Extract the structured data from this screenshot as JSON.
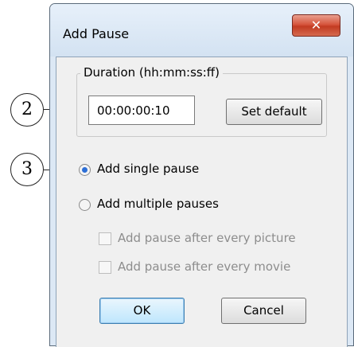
{
  "dialog": {
    "title": "Add Pause",
    "close_glyph": "✕"
  },
  "duration": {
    "group_label": "Duration (hh:mm:ss:ff)",
    "value": "00:00:00:10",
    "set_default_label": "Set default"
  },
  "options": {
    "single_label": "Add single pause",
    "multiple_label": "Add multiple pauses",
    "selected": "single",
    "after_picture_label": "Add pause after every picture",
    "after_movie_label": "Add pause after every movie"
  },
  "buttons": {
    "ok_label": "OK",
    "cancel_label": "Cancel"
  },
  "callouts": {
    "duration_number": "2",
    "single_number": "3"
  }
}
